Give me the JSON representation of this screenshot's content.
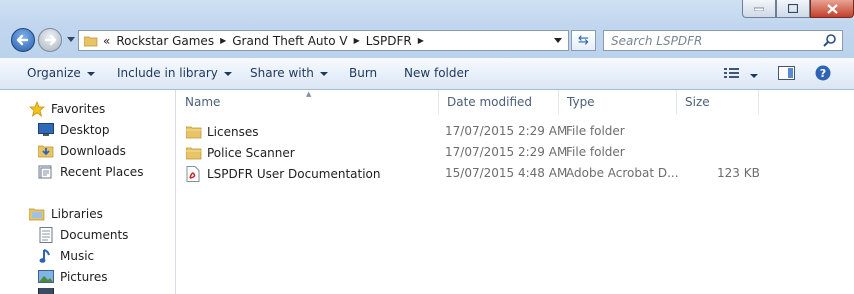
{
  "address": {
    "overflow": "«",
    "crumbs": [
      "Rockstar Games",
      "Grand Theft Auto V",
      "LSPDFR"
    ]
  },
  "search": {
    "placeholder": "Search LSPDFR"
  },
  "toolbar": {
    "organize": "Organize",
    "include_in_library": "Include in library",
    "share_with": "Share with",
    "burn": "Burn",
    "new_folder": "New folder"
  },
  "nav": {
    "favorites": "Favorites",
    "desktop": "Desktop",
    "downloads": "Downloads",
    "recent_places": "Recent Places",
    "libraries": "Libraries",
    "documents": "Documents",
    "music": "Music",
    "pictures": "Pictures"
  },
  "columns": {
    "name": "Name",
    "date_modified": "Date modified",
    "type": "Type",
    "size": "Size"
  },
  "files": [
    {
      "name": "Licenses",
      "date": "17/07/2015 2:29 AM",
      "type": "File folder",
      "size": "",
      "icon": "folder-icon"
    },
    {
      "name": "Police Scanner",
      "date": "17/07/2015 2:29 AM",
      "type": "File folder",
      "size": "",
      "icon": "folder-icon"
    },
    {
      "name": "LSPDFR User Documentation",
      "date": "15/07/2015 4:48 AM",
      "type": "Adobe Acrobat D...",
      "size": "123 KB",
      "icon": "pdf-icon"
    }
  ],
  "colors": {
    "accent": "#1e395b",
    "folder": "#e8c466",
    "pdf": "#c0282d",
    "selection_blue": "#2a63b8"
  }
}
